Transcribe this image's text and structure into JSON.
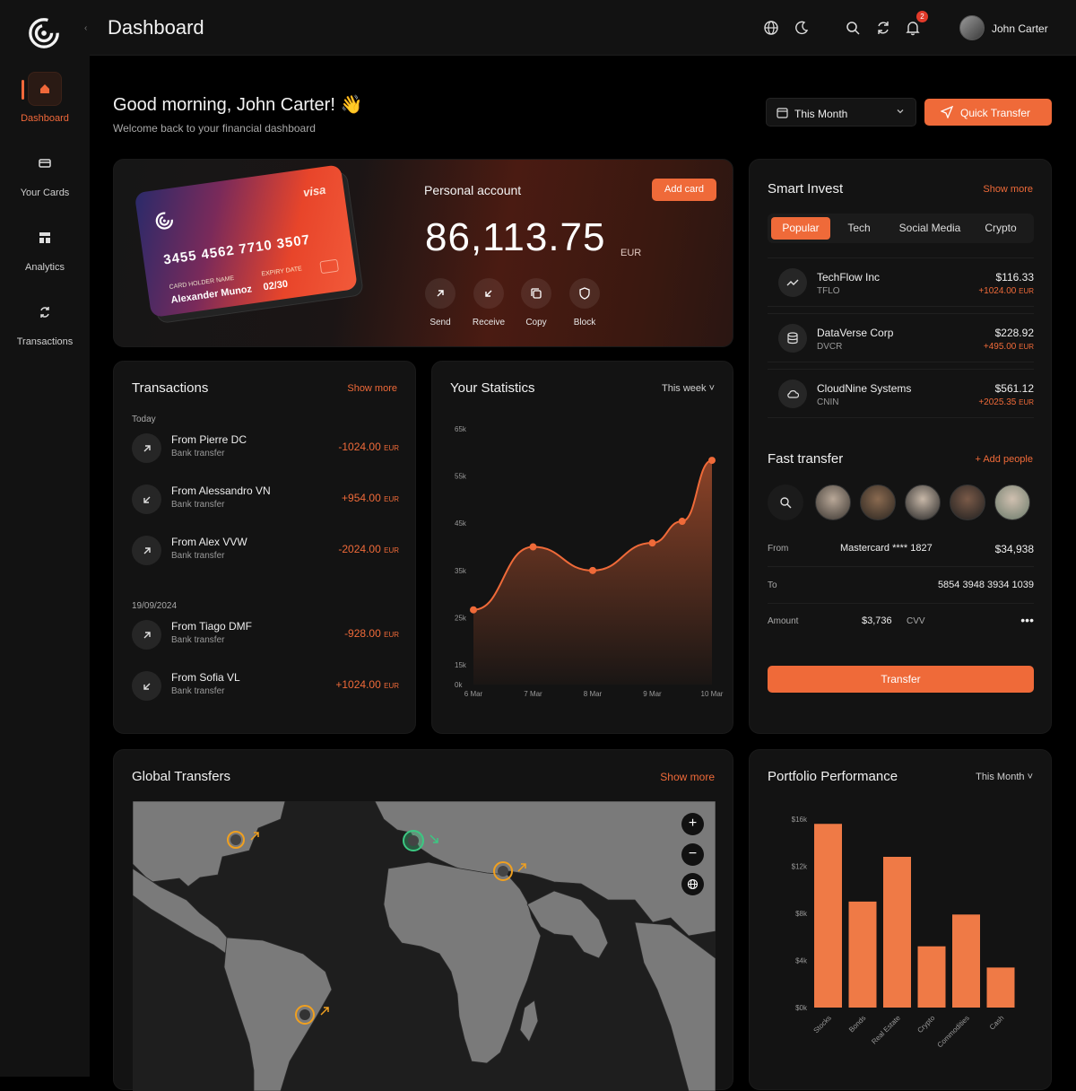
{
  "colors": {
    "accent": "#ef6a39",
    "background": "#000000",
    "panel": "#131313"
  },
  "sidebar": {
    "items": [
      {
        "label": "Dashboard",
        "icon": "home-icon",
        "active": true
      },
      {
        "label": "Your Cards",
        "icon": "card-icon"
      },
      {
        "label": "Analytics",
        "icon": "analytics-icon"
      },
      {
        "label": "Transactions",
        "icon": "refresh-icon"
      }
    ]
  },
  "header": {
    "title": "Dashboard",
    "user_name": "John Carter",
    "notification_count": "2"
  },
  "greeting": {
    "title": "Good morning, John Carter! 👋",
    "subtitle": "Welcome back to your financial dashboard"
  },
  "controls": {
    "period": "This Month",
    "quick_transfer": "Quick Transfer"
  },
  "account": {
    "label": "Personal account",
    "balance": "86,113.75",
    "currency": "EUR",
    "add_card": "Add card",
    "card": {
      "number": "3455 4562 7710 3507",
      "brand": "visa",
      "holder_label": "CARD HOLDER NAME",
      "holder": "Alexander Munoz",
      "expiry_label": "EXPIRY DATE",
      "expiry": "02/30"
    },
    "actions": [
      {
        "label": "Send"
      },
      {
        "label": "Receive"
      },
      {
        "label": "Copy"
      },
      {
        "label": "Block"
      }
    ]
  },
  "transactions": {
    "title": "Transactions",
    "show_more": "Show more",
    "groups": [
      {
        "label": "Today",
        "items": [
          {
            "name": "From Pierre DC",
            "type": "Bank transfer",
            "amount": "-1024.00",
            "currency": "EUR",
            "dir": "out"
          },
          {
            "name": "From Alessandro VN",
            "type": "Bank transfer",
            "amount": "+954.00",
            "currency": "EUR",
            "dir": "in"
          },
          {
            "name": "From Alex VVW",
            "type": "Bank transfer",
            "amount": "-2024.00",
            "currency": "EUR",
            "dir": "out"
          }
        ]
      },
      {
        "label": "19/09/2024",
        "items": [
          {
            "name": "From Tiago DMF",
            "type": "Bank transfer",
            "amount": "-928.00",
            "currency": "EUR",
            "dir": "out"
          },
          {
            "name": "From Sofia VL",
            "type": "Bank transfer",
            "amount": "+1024.00",
            "currency": "EUR",
            "dir": "in"
          }
        ]
      }
    ]
  },
  "statistics": {
    "title": "Your Statistics",
    "period": "This week"
  },
  "smart_invest": {
    "title": "Smart Invest",
    "show_more": "Show more",
    "tabs": [
      "Popular",
      "Tech",
      "Social Media",
      "Crypto"
    ],
    "items": [
      {
        "name": "TechFlow Inc",
        "ticker": "TFLO",
        "price": "$116.33",
        "change": "+1024.00",
        "currency": "EUR",
        "icon": "trend-icon"
      },
      {
        "name": "DataVerse Corp",
        "ticker": "DVCR",
        "price": "$228.92",
        "change": "+495.00",
        "currency": "EUR",
        "icon": "database-icon"
      },
      {
        "name": "CloudNine Systems",
        "ticker": "CNIN",
        "price": "$561.12",
        "change": "+2025.35",
        "currency": "EUR",
        "icon": "cloud-icon"
      }
    ]
  },
  "fast_transfer": {
    "title": "Fast transfer",
    "add_people": "+ Add people",
    "from_label": "From",
    "from_account": "Mastercard **** 1827",
    "from_balance": "$34,938",
    "to_label": "To",
    "to_account": "5854 3948 3934 1039",
    "amount_label": "Amount",
    "amount": "$3,736",
    "cvv_label": "CVV",
    "cvv": "•••",
    "button": "Transfer"
  },
  "global_transfers": {
    "title": "Global Transfers",
    "show_more": "Show more"
  },
  "portfolio": {
    "title": "Portfolio Performance",
    "period": "This Month"
  },
  "chart_data": [
    {
      "type": "area",
      "x": [
        "6 Mar",
        "7 Mar",
        "8 Mar",
        "9 Mar",
        "10 Mar"
      ],
      "y_ticks": [
        "65k",
        "55k",
        "45k",
        "35k",
        "25k",
        "15k",
        "0k"
      ],
      "series": [
        {
          "values": [
            19000,
            35000,
            29000,
            36000,
            41500,
            57000
          ]
        }
      ],
      "x_points": [
        0,
        1,
        2,
        3,
        3.5,
        4
      ],
      "ylim": [
        0,
        65000
      ]
    },
    {
      "type": "bar",
      "categories": [
        "Stocks",
        "Bonds",
        "Real Estate",
        "Crypto",
        "Commodities",
        "Cash"
      ],
      "values": [
        15600,
        9000,
        12800,
        5200,
        7900,
        3400
      ],
      "y_ticks": [
        "$16k",
        "$12k",
        "$8k",
        "$4k",
        "$0k"
      ],
      "ylim": [
        0,
        16000
      ]
    }
  ]
}
